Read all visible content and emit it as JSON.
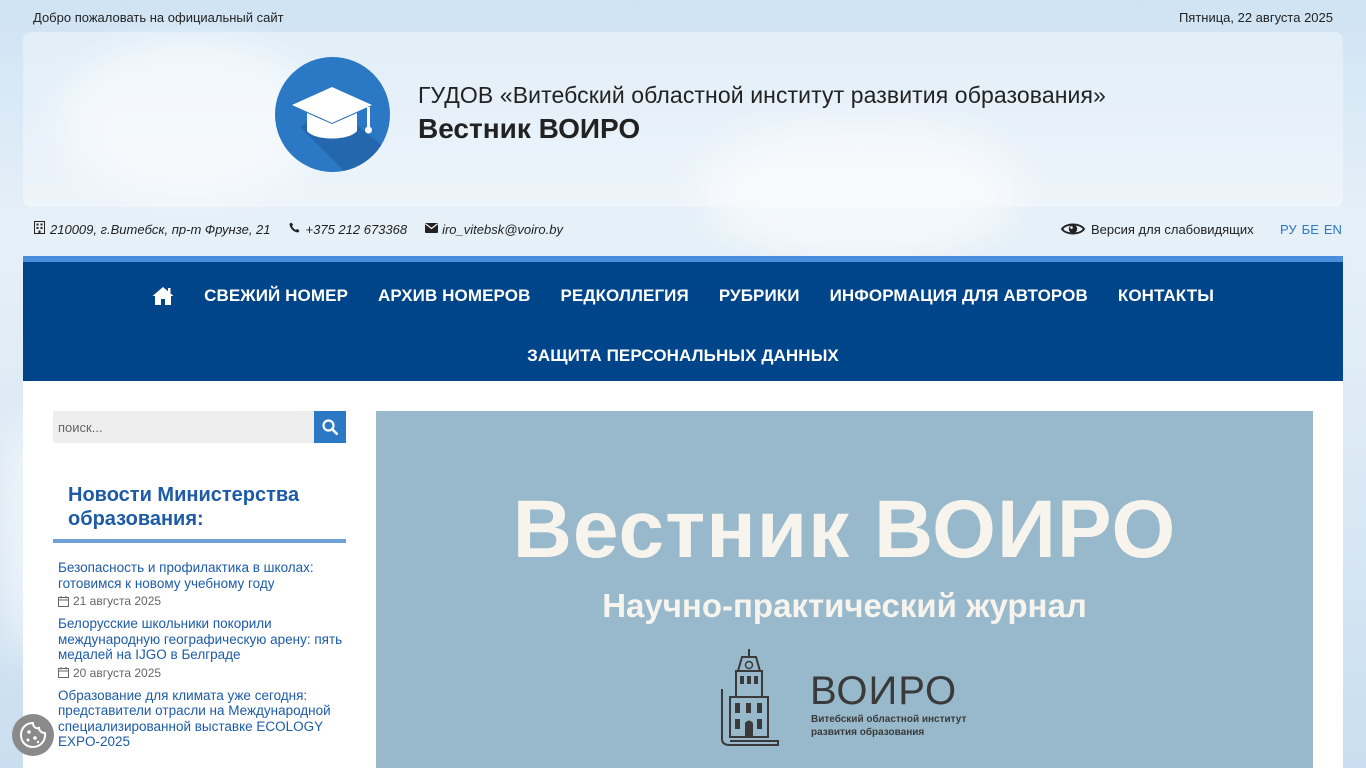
{
  "topbar": {
    "welcome": "Добро пожаловать на официальный сайт",
    "date": "Пятница, 22 августа 2025"
  },
  "header": {
    "org_name": "ГУДОВ «Витебский областной институт развития образования»",
    "journal_name": "Вестник ВОИРО",
    "logo_icon": "graduation-cap-icon"
  },
  "contacts": {
    "address": "210009, г.Витебск, пр-т Фрунзе, 21",
    "phone": "+375 212 673368",
    "email": "iro_vitebsk@voiro.by"
  },
  "accessibility": {
    "label": "Версия для слабовидящих"
  },
  "languages": [
    "РУ",
    "БЕ",
    "EN"
  ],
  "nav": {
    "items": [
      "Свежий номер",
      "Архив номеров",
      "Редколлегия",
      "Рубрики",
      "Информация для авторов",
      "Контакты"
    ],
    "second_row": "Защита персональных данных"
  },
  "search": {
    "placeholder": "поиск..."
  },
  "news": {
    "title": "Новости Министерства образования:",
    "items": [
      {
        "title": "Безопасность и профилактика в школах: готовимся к новому учебному году",
        "date": "21 августа 2025"
      },
      {
        "title": "Белорусские школьники покорили международную географическую арену: пять медалей на IJGO в Белграде",
        "date": "20 августа 2025"
      },
      {
        "title": "Образование для климата уже сегодня: представители отрасли на Международной специализированной выставке ECOLOGY EXPO-2025",
        "date": ""
      }
    ]
  },
  "banner": {
    "title": "Вестник ВОИРО",
    "subtitle": "Научно-практический журнал",
    "abbr": "ВОИРО",
    "institute_line1": "Витебский областной институт",
    "institute_line2": "развития образования"
  },
  "colors": {
    "nav_bg": "#00448a",
    "nav_border": "#4a8fde",
    "accent": "#2b78c5",
    "link": "#1d5ba8",
    "banner_bg": "#98b9cb"
  }
}
